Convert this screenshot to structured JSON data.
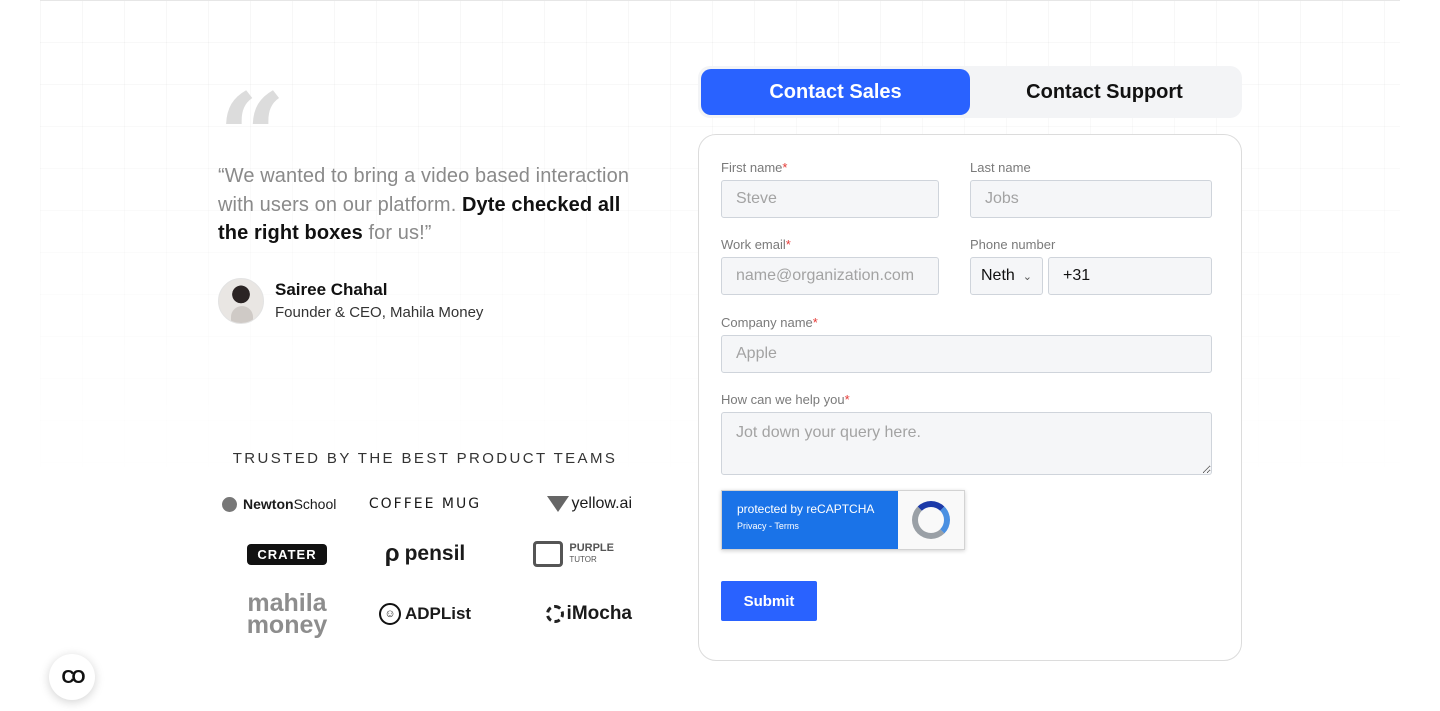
{
  "testimonial": {
    "quote_mark": "“",
    "quote_start": "“We wanted to bring a video based interaction with users on our platform. ",
    "quote_bold": "Dyte checked all the right boxes",
    "quote_end": " for us!”",
    "author_name": "Sairee Chahal",
    "author_role": "Founder & CEO, Mahila Money"
  },
  "trusted": {
    "heading": "TRUSTED BY THE BEST PRODUCT TEAMS",
    "logos": {
      "newton": "Newton School",
      "newton_bold": "Newton",
      "newton_rest": " School",
      "coffee": "COFFEE MUG",
      "yellow": "yellow.ai",
      "crater": "CRATER",
      "pensil": "pensil",
      "pensil_icon": "ρ",
      "purple_top": "PURPLE",
      "purple_bottom": "TUTOR",
      "mahila_top": "mahila",
      "mahila_bottom": "money",
      "adplist": "ADPList",
      "imocha": "iMocha"
    }
  },
  "tabs": {
    "sales": "Contact Sales",
    "support": "Contact Support"
  },
  "form": {
    "first_name": {
      "label": "First name",
      "required": "*",
      "placeholder": "Steve"
    },
    "last_name": {
      "label": "Last name",
      "placeholder": "Jobs"
    },
    "work_email": {
      "label": "Work email",
      "required": "*",
      "placeholder": "name@organization.com"
    },
    "phone": {
      "label": "Phone number",
      "country": "Neth",
      "code": "+31"
    },
    "company": {
      "label": "Company name",
      "required": "*",
      "placeholder": "Apple"
    },
    "help": {
      "label": "How can we help you",
      "required": "*",
      "placeholder": "Jot down your query here."
    },
    "recaptcha": {
      "line1": "protected by reCAPTCHA",
      "line2": "Privacy - Terms"
    },
    "submit": "Submit"
  },
  "chat": {
    "icon": "chat-link-icon",
    "glyph": "CO"
  },
  "colors": {
    "accent": "#2962ff",
    "required": "#e53935"
  }
}
